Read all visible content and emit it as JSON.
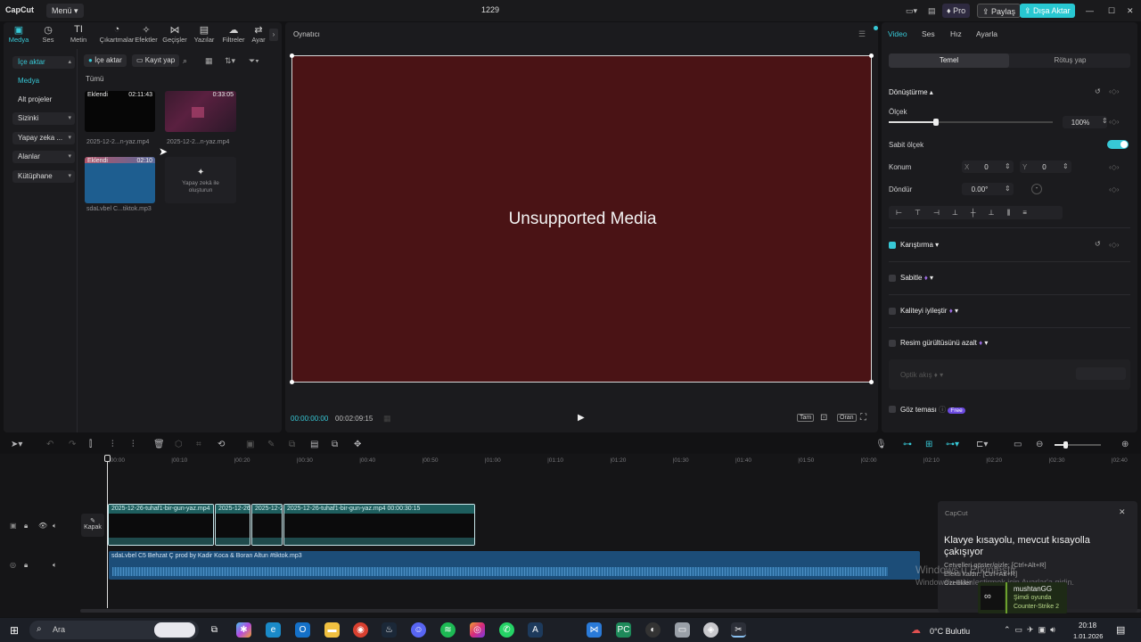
{
  "titlebar": {
    "logo": "CapCut",
    "menu": "Menü",
    "title": "1229",
    "pro": "Pro",
    "share": "Paylaş",
    "export": "Dışa Aktar"
  },
  "media_tabs": [
    {
      "label": "Medya",
      "icon": "media-icon"
    },
    {
      "label": "Ses",
      "icon": "audio-icon"
    },
    {
      "label": "Metin",
      "icon": "text-icon"
    },
    {
      "label": "Çıkartmalar",
      "icon": "sticker-icon"
    },
    {
      "label": "Efektler",
      "icon": "effects-icon"
    },
    {
      "label": "Geçişler",
      "icon": "transitions-icon"
    },
    {
      "label": "Yazılar",
      "icon": "captions-icon"
    },
    {
      "label": "Filtreler",
      "icon": "filters-icon"
    },
    {
      "label": "Ayar",
      "icon": "adjust-icon"
    }
  ],
  "sidebar": {
    "import_header": "İçe aktar",
    "media": "Medya",
    "sub_projects": "Alt projeler",
    "yours": "Sizinki",
    "ai": "Yapay zeka ...",
    "spaces": "Alanlar",
    "library": "Kütüphane"
  },
  "media_toolbar": {
    "import": "İçe aktar",
    "record": "Kayıt yap"
  },
  "media_section": "Tümü",
  "media_items": [
    {
      "badge": "Eklendi",
      "duration": "02:11:43",
      "name": "2025-12-2...n-yaz.mp4"
    },
    {
      "badge": "",
      "duration": "0:33:05",
      "name": "2025-12-2...n-yaz.mp4"
    },
    {
      "badge": "Eklendi",
      "duration": "02:10",
      "name": "sdaLvbel C...tiktok.mp3"
    }
  ],
  "ai_create": "Yapay zekâ ile oluşturun",
  "player": {
    "title": "Oynatıcı",
    "unsupported": "Unsupported Media",
    "current_time": "00:00:00:00",
    "total_time": "00:02:09:15",
    "full": "Tam",
    "ratio": "Oran"
  },
  "inspector": {
    "tabs": [
      "Video",
      "Ses",
      "Hız",
      "Ayarla"
    ],
    "subtabs": [
      "Temel",
      "Rötuş yap"
    ],
    "transform": "Dönüştürme",
    "scale": "Ölçek",
    "scale_value": "100%",
    "scale_level": 0.29,
    "uniform_scale": "Sabit ölçek",
    "position": "Konum",
    "x_label": "X",
    "x_value": "0",
    "y_label": "Y",
    "y_value": "0",
    "rotate": "Döndür",
    "rotate_value": "0.00°",
    "blend": "Karıştırma",
    "stabilize": "Sabitle",
    "enhance": "Kaliteyi iyileştir",
    "denoise": "Resim gürültüsünü azalt",
    "optical_flow": "Optik akış",
    "eye_contact": "Göz teması",
    "free_badge": "Free"
  },
  "timeline": {
    "ruler": [
      "00:00",
      "00:10",
      "00:20",
      "00:30",
      "00:40",
      "00:50",
      "01:00",
      "01:10",
      "01:20",
      "01:30",
      "01:40",
      "01:50",
      "02:00",
      "02:10",
      "02:20",
      "02:30",
      "02:40"
    ],
    "cover": "Kapak",
    "clips": [
      "2025-12-26-tuhaf1-bir-gun-yaz.mp4",
      "2025-12-26",
      "2025-12-2",
      "2025-12-26-tuhaf1-bir-gun-yaz.mp4  00:00:30:15"
    ],
    "audio_clip": "sdaLvbel C5   Behzat Ç prod  by Kadir Koca & Boran Altun #tiktok.mp3"
  },
  "notification": {
    "app": "CapCut",
    "title": "Klavye kısayolu, mevcut kısayolla çakışıyor",
    "line1": "Cetvelleri göster/gizle: [Ctrl+Alt+R]",
    "line2": "Efekti kaldır: [Ctrl+Alt+R]",
    "line3": "Özellikler"
  },
  "watermark": {
    "line1": "Windows'u Etkinleştir",
    "line2": "Windows'u etkinleştirmek için Ayarlar'a gidin."
  },
  "game_toast": {
    "user": "mushtanGG",
    "status": "Şimdi oyunda",
    "game": "Counter-Strike 2"
  },
  "taskbar": {
    "search": "Ara",
    "weather": "0°C  Bulutlu",
    "time": "20:18",
    "date": "1.01.2026"
  },
  "colors": {
    "accent": "#37c8d6",
    "export": "#28c8d2",
    "video_bg": "#4a1315",
    "audio_clip": "#1c4d78"
  }
}
